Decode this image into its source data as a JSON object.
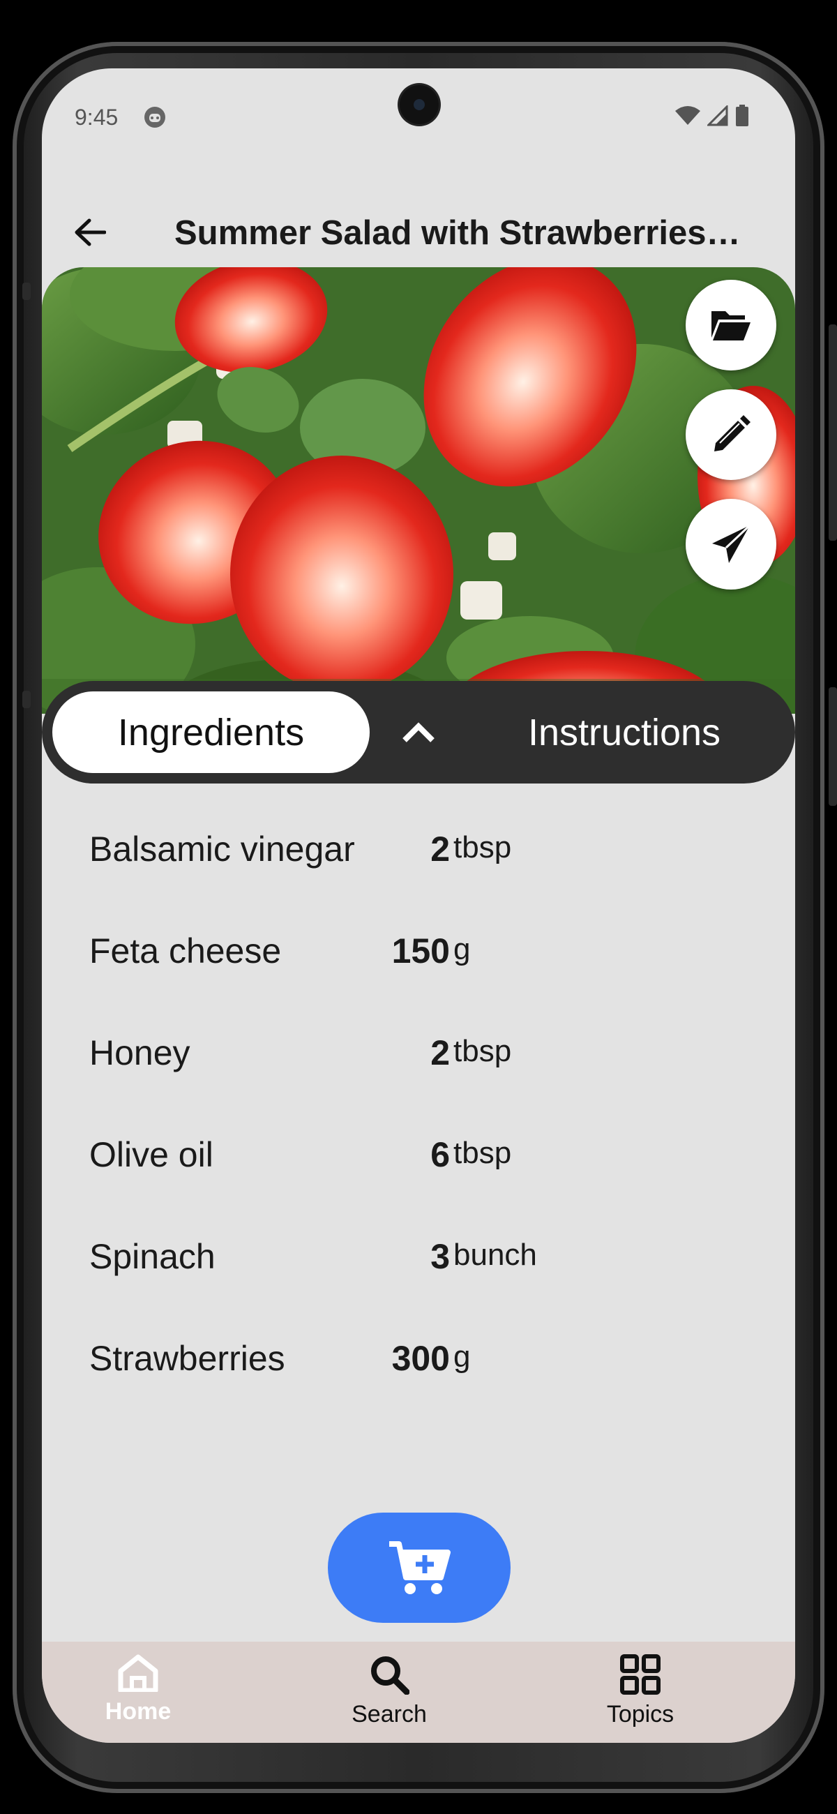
{
  "status_bar": {
    "time": "9:45"
  },
  "header": {
    "title": "Summer Salad with Strawberries…"
  },
  "tabs": {
    "ingredients": "Ingredients",
    "instructions": "Instructions"
  },
  "ingredients": [
    {
      "name": "Balsamic vinegar",
      "amount": "2",
      "unit": "tbsp"
    },
    {
      "name": "Feta cheese",
      "amount": "150",
      "unit": "g"
    },
    {
      "name": "Honey",
      "amount": "2",
      "unit": "tbsp"
    },
    {
      "name": "Olive oil",
      "amount": "6",
      "unit": "tbsp"
    },
    {
      "name": "Spinach",
      "amount": "3",
      "unit": "bunch"
    },
    {
      "name": "Strawberries",
      "amount": "300",
      "unit": "g"
    }
  ],
  "nav": {
    "home": "Home",
    "search": "Search",
    "topics": "Topics"
  },
  "icons": {
    "folder": "folder-open-icon",
    "edit": "pencil-icon",
    "share": "paper-plane-icon",
    "cart": "add-to-cart-icon"
  },
  "colors": {
    "screen_bg": "#e3e3e3",
    "tab_bar_bg": "#2e2e2e",
    "cart_fab": "#3d7cf6",
    "bottom_nav_bg": "#dcd1ce"
  }
}
